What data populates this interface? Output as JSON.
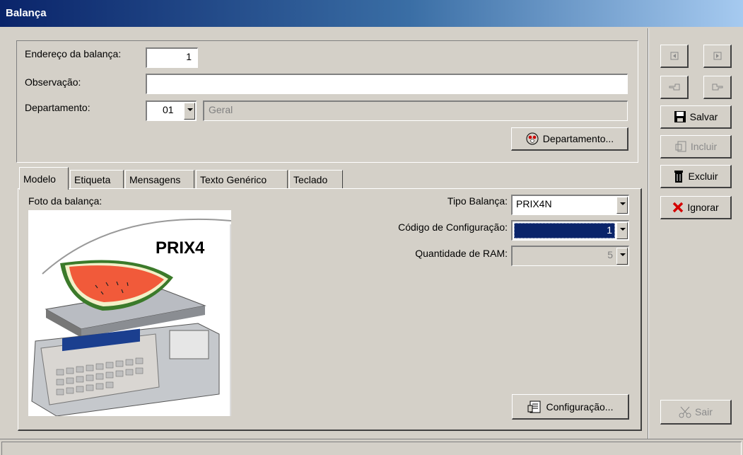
{
  "window": {
    "title": "Balança"
  },
  "header": {
    "endereco_label": "Endereço da balança:",
    "endereco_value": "1",
    "observacao_label": "Observação:",
    "observacao_value": "",
    "departamento_label": "Departamento:",
    "departamento_code": "01",
    "departamento_name": "Geral",
    "departamento_button": "Departamento..."
  },
  "tabs": [
    {
      "label": "Modelo",
      "active": true
    },
    {
      "label": "Etiqueta"
    },
    {
      "label": "Mensagens"
    },
    {
      "label": "Texto Genérico"
    },
    {
      "label": "Teclado"
    }
  ],
  "modelo": {
    "foto_label": "Foto da balança:",
    "photo_brand": "PRIX4",
    "tipo_label": "Tipo Balança:",
    "tipo_value": "PRIX4N",
    "codigo_label": "Código de Configuração:",
    "codigo_value": "1",
    "ram_label": "Quantidade de RAM:",
    "ram_value": "5",
    "configuracao_button": "Configuração..."
  },
  "sidebar": {
    "salvar": "Salvar",
    "incluir": "Incluir",
    "excluir": "Excluir",
    "ignorar": "Ignorar",
    "sair": "Sair"
  },
  "colors": {
    "title_gradient_start": "#0a246a",
    "selection": "#0a246a",
    "face": "#d4d0c8"
  }
}
